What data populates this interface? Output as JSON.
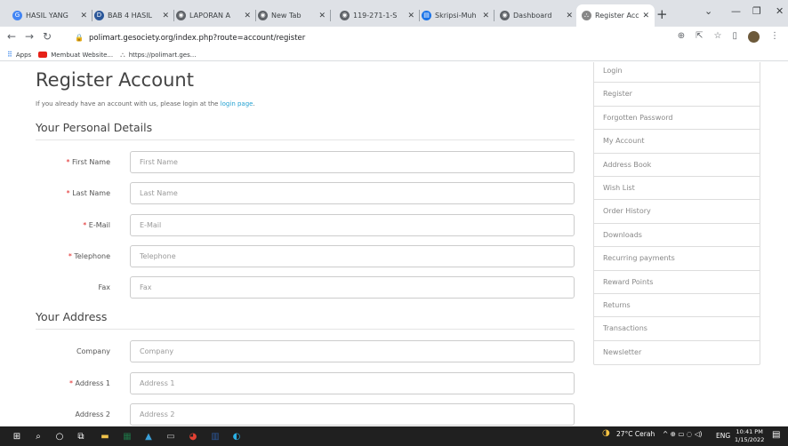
{
  "browser": {
    "tabs": [
      {
        "title": "HASIL YANG",
        "favicon": "G",
        "favcolor": "#4285f4"
      },
      {
        "title": "BAB 4 HASIL",
        "favicon": "D",
        "favcolor": "#2b579a"
      },
      {
        "title": "LAPORAN A",
        "favicon": "◉",
        "favcolor": "#5f6368"
      },
      {
        "title": "New Tab",
        "favicon": "◉",
        "favcolor": "#5f6368"
      },
      {
        "title": "119-271-1-S",
        "favicon": "◉",
        "favcolor": "#5f6368"
      },
      {
        "title": "Skripsi-Muh",
        "favicon": "▤",
        "favcolor": "#1a73e8"
      },
      {
        "title": "Dashboard",
        "favicon": "◉",
        "favcolor": "#5f6368"
      },
      {
        "title": "Register Acc",
        "favicon": "⛬",
        "favcolor": "#888888"
      }
    ],
    "new_tab": "+",
    "url": "polimart.gesociety.org/index.php?route=account/register",
    "bookmarks": [
      {
        "label": "Apps"
      },
      {
        "label": "Membuat Website..."
      },
      {
        "label": "https://polimart.ges..."
      }
    ]
  },
  "page": {
    "title": "Register Account",
    "intro_text": "If you already have an account with us, please login at the ",
    "intro_link": "login page",
    "intro_end": ".",
    "section_personal": "Your Personal Details",
    "section_address": "Your Address",
    "fields": [
      {
        "label": "First Name",
        "required": true,
        "placeholder": "First Name"
      },
      {
        "label": "Last Name",
        "required": true,
        "placeholder": "Last Name"
      },
      {
        "label": "E-Mail",
        "required": true,
        "placeholder": "E-Mail"
      },
      {
        "label": "Telephone",
        "required": true,
        "placeholder": "Telephone"
      },
      {
        "label": "Fax",
        "required": false,
        "placeholder": "Fax"
      }
    ],
    "address_fields": [
      {
        "label": "Company",
        "required": false,
        "placeholder": "Company"
      },
      {
        "label": "Address 1",
        "required": true,
        "placeholder": "Address 1"
      },
      {
        "label": "Address 2",
        "required": false,
        "placeholder": "Address 2"
      }
    ],
    "sidebar": [
      "Login",
      "Register",
      "Forgotten Password",
      "My Account",
      "Address Book",
      "Wish List",
      "Order History",
      "Downloads",
      "Recurring payments",
      "Reward Points",
      "Returns",
      "Transactions",
      "Newsletter"
    ]
  },
  "taskbar": {
    "weather": "27°C Cerah",
    "lang": "ENG",
    "time": "10:41 PM",
    "date": "1/15/2022"
  }
}
